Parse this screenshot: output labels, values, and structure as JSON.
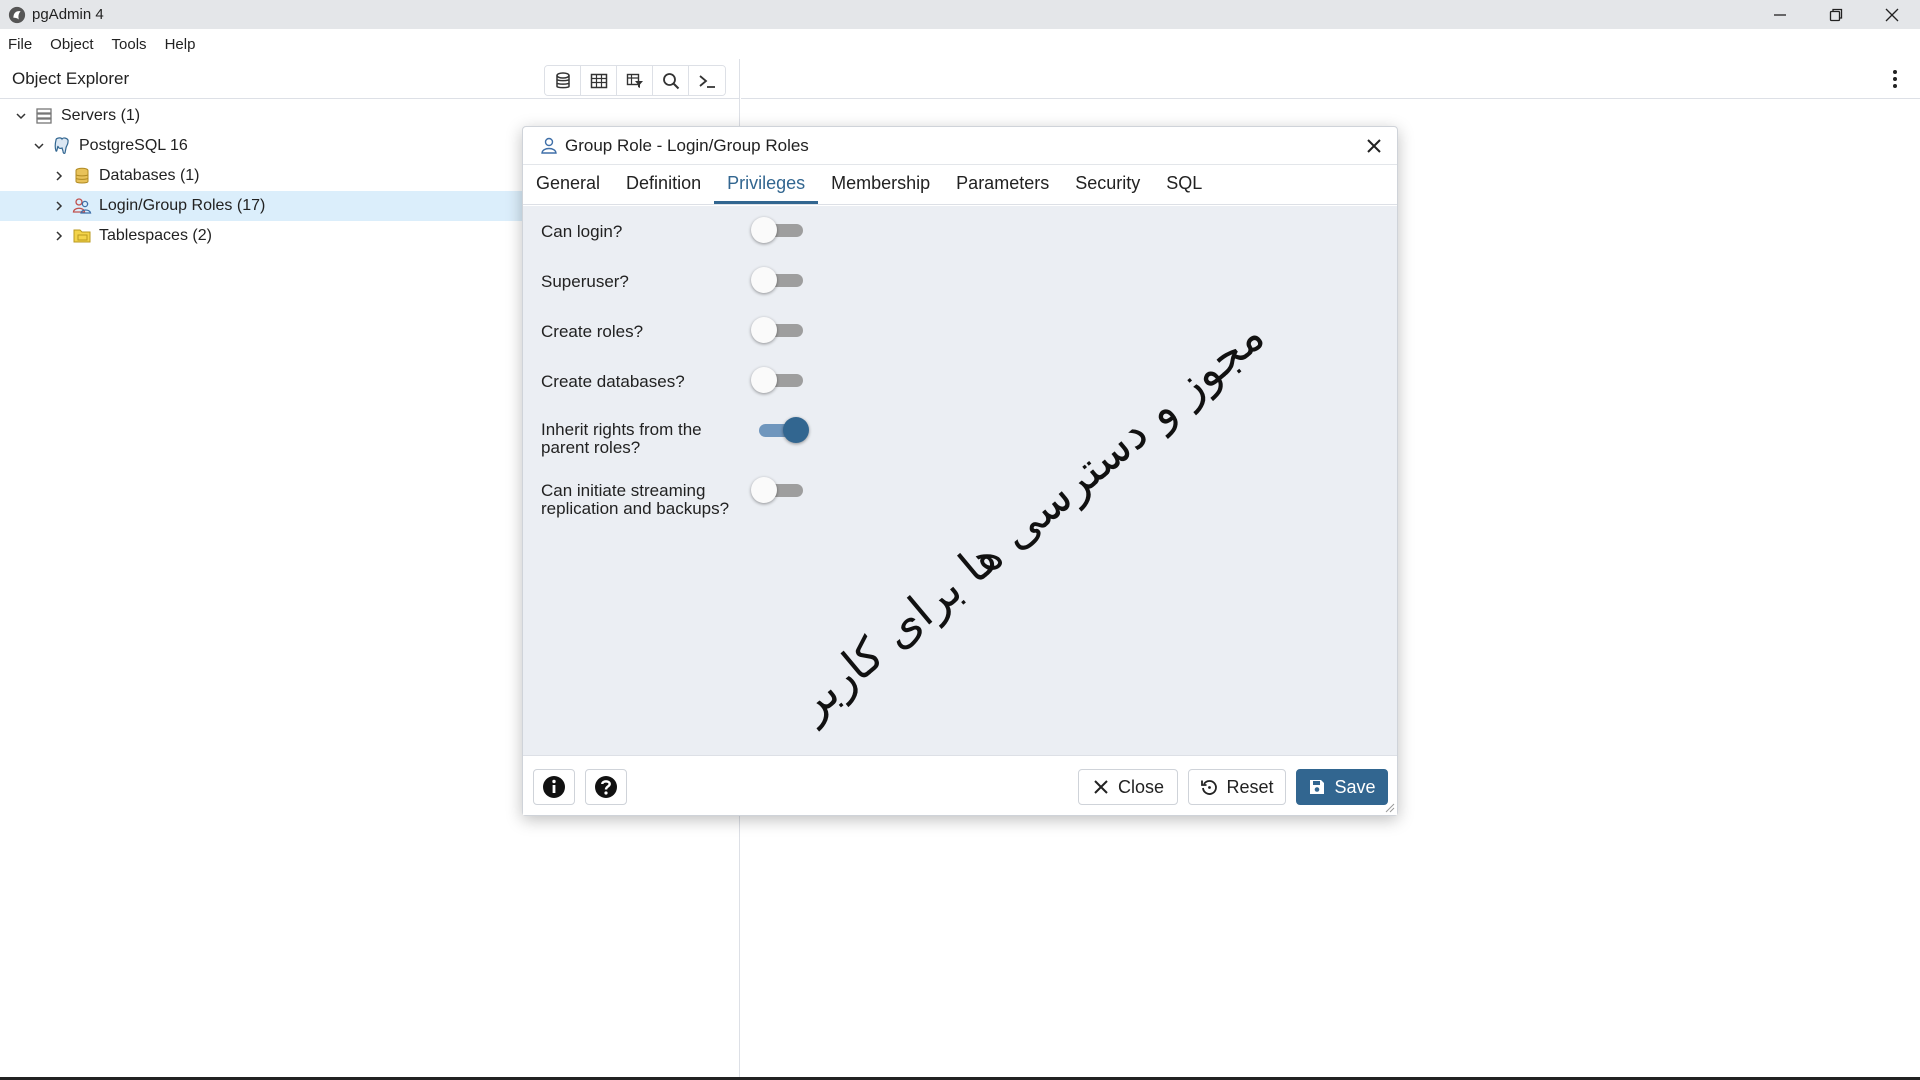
{
  "window": {
    "title": "pgAdmin 4"
  },
  "menu": [
    "File",
    "Object",
    "Tools",
    "Help"
  ],
  "explorer": {
    "title": "Object Explorer",
    "tree": [
      {
        "label": "Servers (1)",
        "icon": "servers-icon"
      },
      {
        "label": "PostgreSQL 16",
        "icon": "postgresql-elephant-icon"
      },
      {
        "label": "Databases (1)",
        "icon": "databases-icon"
      },
      {
        "label": "Login/Group Roles (17)",
        "icon": "group-roles-icon",
        "selected": true
      },
      {
        "label": "Tablespaces (2)",
        "icon": "tablespaces-icon"
      }
    ]
  },
  "dialog": {
    "title": "Group Role - Login/Group Roles",
    "tabs": [
      "General",
      "Definition",
      "Privileges",
      "Membership",
      "Parameters",
      "Security",
      "SQL"
    ],
    "active_tab": "Privileges",
    "privileges": [
      {
        "label": "Can login?",
        "on": false
      },
      {
        "label": "Superuser?",
        "on": false
      },
      {
        "label": "Create roles?",
        "on": false
      },
      {
        "label": "Create databases?",
        "on": false
      },
      {
        "label": "Inherit rights from the parent roles?",
        "on": true
      },
      {
        "label": "Can initiate streaming replication and backups?",
        "on": false
      }
    ],
    "watermark": "مجوز و دسترسی ها برای کاربر",
    "footer": {
      "close_label": "Close",
      "reset_label": "Reset",
      "save_label": "Save"
    }
  },
  "colors": {
    "accent": "#326690",
    "selected_row": "#dbeefb",
    "body_bg": "#ebeef3"
  }
}
